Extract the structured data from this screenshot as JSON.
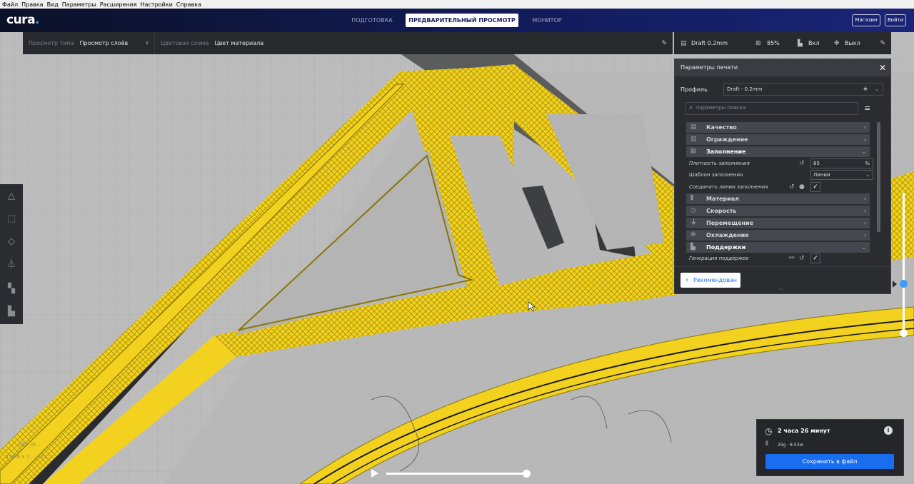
{
  "menu": [
    "Файл",
    "Правка",
    "Вид",
    "Параметры",
    "Расширения",
    "Настройки",
    "Справка"
  ],
  "app": {
    "logo": "cura",
    "logo_dot": "."
  },
  "stages": [
    "ПОДГОТОВКА",
    "ПРЕДВАРИТЕЛЬНЫЙ ПРОСМОТР",
    "МОНИТОР"
  ],
  "top_buttons": {
    "marketplace": "Магазин",
    "login": "Войти"
  },
  "view": {
    "view_type_label": "Просмотр типа",
    "view_type_value": "Просмотр слоёв",
    "color_scheme_label": "Цветовая схема",
    "color_scheme_value": "Цвет материала"
  },
  "summary": {
    "profile": "Draft 0.2mm",
    "infill": "85%",
    "support": "Вкл",
    "adhesion": "Выкл"
  },
  "panel": {
    "title": "Параметры печати",
    "profile_label": "Профиль",
    "profile_value": "Draft - 0.2mm",
    "search_placeholder": "параметры поиска",
    "categories": {
      "quality": "Качество",
      "walls": "Ограждение",
      "infill": "Заполнение",
      "material": "Материал",
      "speed": "Скорость",
      "travel": "Перемещение",
      "cooling": "Охлаждение",
      "support": "Поддержки"
    },
    "settings": {
      "infill_density_label": "Плотность заполнения",
      "infill_density_value": "85",
      "infill_density_unit": "%",
      "infill_pattern_label": "Шаблон заполнения",
      "infill_pattern_value": "Линии",
      "connect_infill_label": "Соединять линии заполнения",
      "generate_support_label": "Генерация поддержек"
    },
    "recommended_button": "Рекомендован"
  },
  "estimate": {
    "time": "2 часа 26 минут",
    "material": "25g · 8.53m",
    "save_button": "Сохранить в файл"
  },
  "object_info": {
    "name": "CE3_dr...",
    "dims": "156.6 x 7... x 21..."
  },
  "colors": {
    "accent": "#196ef0",
    "filament": "#f2d21e",
    "slider": "#3c9dff",
    "topbar": "#121c5c"
  }
}
